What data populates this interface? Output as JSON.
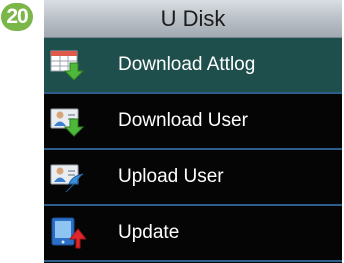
{
  "step_badge": "20",
  "title": "U Disk",
  "menu": {
    "items": [
      {
        "label": "Download Attlog",
        "icon": "table-download-icon",
        "selected": true
      },
      {
        "label": "Download User",
        "icon": "user-card-download-icon",
        "selected": false
      },
      {
        "label": "Upload User",
        "icon": "user-card-upload-icon",
        "selected": false
      },
      {
        "label": "Update",
        "icon": "device-update-icon",
        "selected": false
      }
    ]
  },
  "colors": {
    "badge": "#7ab648",
    "screen_background": "#050505",
    "selected_row": "#1f4f4c",
    "row_divider": "#2b5e8a",
    "title_bar": "#b7bec5",
    "download_arrow": "#4db83a",
    "upload_arrow": "#3a8fd8",
    "update_arrow": "#e0262a"
  }
}
